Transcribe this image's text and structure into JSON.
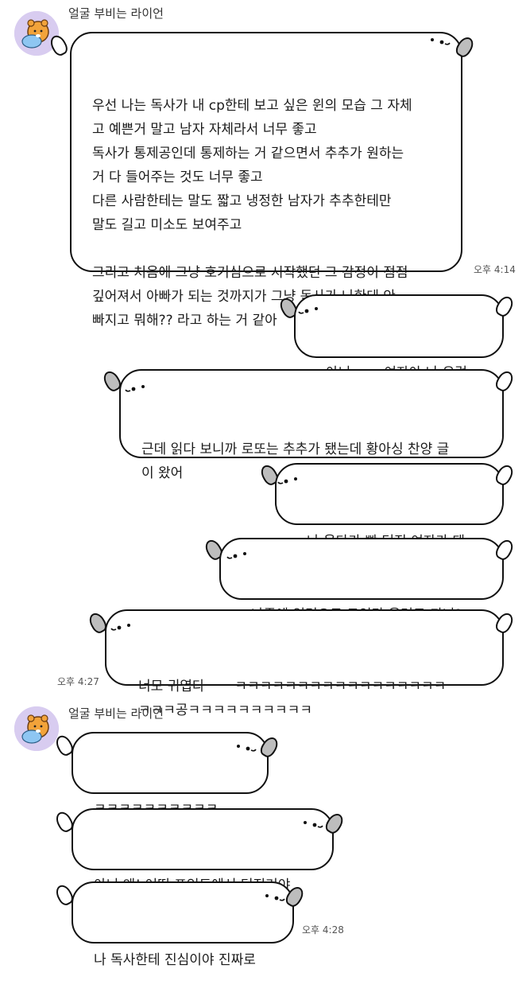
{
  "conversation": {
    "sender_name_1": "얼굴 부비는 라이언",
    "sender_name_2": "얼굴 부비는 라이언",
    "messages": [
      {
        "text": "우선 나는 독사가 내 cp한테 보고 싶은 윈의 모습 그 자체\n고 예쁜거 말고 남자 자체라서 너무 좋고\n독사가 통제공인데 통제하는 거 같으면서 추추가 원하는\n거 다 들어주는 것도 너무 좋고\n다른 사람한테는 말도 짧고 냉정한 남자가 추추한테만\n말도 길고 미소도 보여주고\n\n그리고 처음에 그냥 호기심으로 시작했던 그 감정이 점점\n깊어져서 아빠가 되는 것까지가 그냥 독사가 나한테 안\n빠지고 뭐해?? 라고 하는 거 같아",
        "time": "오후 4:14"
      },
      {
        "text": "아니 ㅠㅠ 여자야 나 우렁"
      },
      {
        "text": "근데 읽다 보니까 로또는 추추가 됐는데 황아싱 찬양 글\n이 왔어"
      },
      {
        "text": "나 울다가 빵 터진 여자가 돼"
      },
      {
        "text": "나중에 익명으로 트잇타 올려도 되니?"
      },
      {
        "text": "너모 귀엽다       ㅋㅋㅋㅋㅋㅋㅋㅋㅋㅋㅋㅋㅋㅋㅋㅋㅋ\nㅋㅋㅋ공ㅋㅋㅋㅋㅋㅋㅋㅋㅋㅋ",
        "time": "오후 4:27"
      },
      {
        "text": "ㅋㅋㅋㅋㅋㅋㅋㅋㅋㅋ"
      },
      {
        "text": "아니 왜! 어떤 포인트에서 터진거야"
      },
      {
        "text": "나 독사한테 진심이야 진짜로",
        "time": "오후 4:28"
      }
    ]
  },
  "icons": {
    "avatar": "lion-avatar-icon",
    "bubble_face": "dot-eyes-face-icon",
    "bubble_ear": "ear-icon"
  },
  "colors": {
    "avatar_bg": "#d8ccf0",
    "lion": "#f2a33a",
    "bubble_border": "#111111"
  }
}
